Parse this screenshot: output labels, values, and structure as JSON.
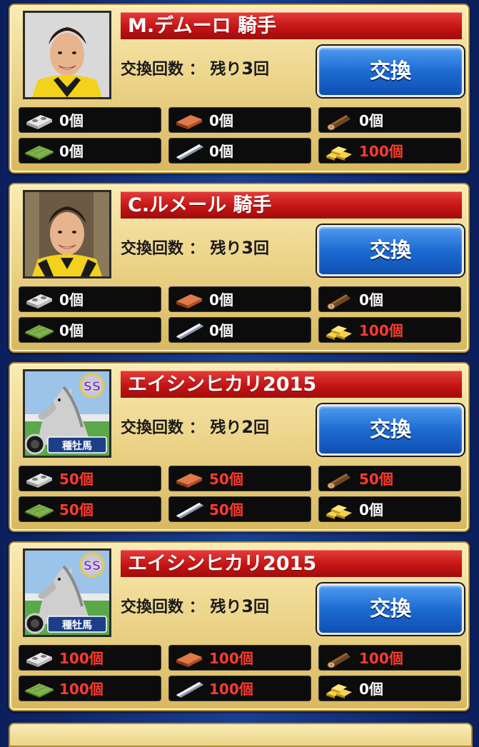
{
  "cards": [
    {
      "type": "jockey",
      "name": "M.デムーロ 騎手",
      "remain_label": "交換回数 ： 残り",
      "remain_count": "3",
      "remain_unit": "回",
      "button": "交換",
      "materials": [
        {
          "icon": "cinder-block-icon",
          "qty": "0個",
          "red": false
        },
        {
          "icon": "brick-icon",
          "qty": "0個",
          "red": false
        },
        {
          "icon": "log-icon",
          "qty": "0個",
          "red": false
        },
        {
          "icon": "green-plank-icon",
          "qty": "0個",
          "red": false
        },
        {
          "icon": "steel-beam-icon",
          "qty": "0個",
          "red": false
        },
        {
          "icon": "gold-bars-icon",
          "qty": "100個",
          "red": true
        }
      ]
    },
    {
      "type": "jockey",
      "name": "C.ルメール 騎手",
      "remain_label": "交換回数 ： 残り",
      "remain_count": "3",
      "remain_unit": "回",
      "button": "交換",
      "materials": [
        {
          "icon": "cinder-block-icon",
          "qty": "0個",
          "red": false
        },
        {
          "icon": "brick-icon",
          "qty": "0個",
          "red": false
        },
        {
          "icon": "log-icon",
          "qty": "0個",
          "red": false
        },
        {
          "icon": "green-plank-icon",
          "qty": "0個",
          "red": false
        },
        {
          "icon": "steel-beam-icon",
          "qty": "0個",
          "red": false
        },
        {
          "icon": "gold-bars-icon",
          "qty": "100個",
          "red": true
        }
      ]
    },
    {
      "type": "horse",
      "name": "エイシンヒカリ2015",
      "rank": "SS",
      "tag": "種牡馬",
      "remain_label": "交換回数 ： 残り",
      "remain_count": "2",
      "remain_unit": "回",
      "button": "交換",
      "materials": [
        {
          "icon": "cinder-block-icon",
          "qty": "50個",
          "red": true
        },
        {
          "icon": "brick-icon",
          "qty": "50個",
          "red": true
        },
        {
          "icon": "log-icon",
          "qty": "50個",
          "red": true
        },
        {
          "icon": "green-plank-icon",
          "qty": "50個",
          "red": true
        },
        {
          "icon": "steel-beam-icon",
          "qty": "50個",
          "red": true
        },
        {
          "icon": "gold-bars-icon",
          "qty": "0個",
          "red": false
        }
      ]
    },
    {
      "type": "horse",
      "name": "エイシンヒカリ2015",
      "rank": "SS",
      "tag": "種牡馬",
      "remain_label": "交換回数 ： 残り",
      "remain_count": "3",
      "remain_unit": "回",
      "button": "交換",
      "materials": [
        {
          "icon": "cinder-block-icon",
          "qty": "100個",
          "red": true
        },
        {
          "icon": "brick-icon",
          "qty": "100個",
          "red": true
        },
        {
          "icon": "log-icon",
          "qty": "100個",
          "red": true
        },
        {
          "icon": "green-plank-icon",
          "qty": "100個",
          "red": true
        },
        {
          "icon": "steel-beam-icon",
          "qty": "100個",
          "red": true
        },
        {
          "icon": "gold-bars-icon",
          "qty": "0個",
          "red": false
        }
      ]
    }
  ]
}
